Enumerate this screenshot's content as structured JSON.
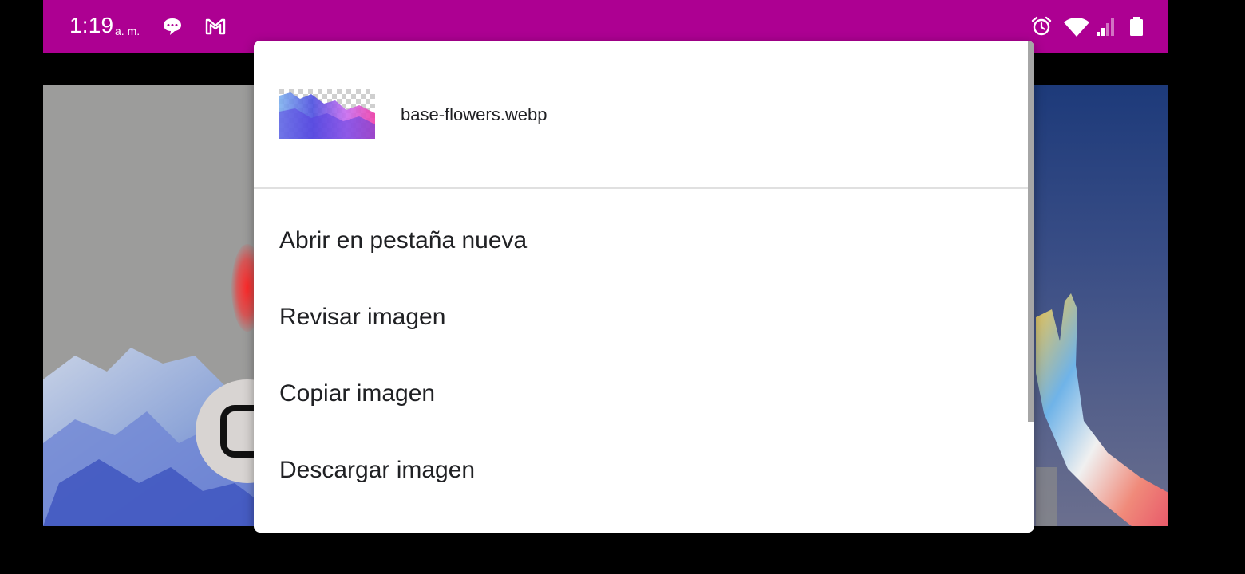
{
  "status_bar": {
    "time": "1:19",
    "ampm": "a. m.",
    "icons": [
      "chat-bubble-icon",
      "gmail-icon",
      "alarm-icon",
      "wifi-icon",
      "signal-icon",
      "battery-icon"
    ],
    "background_color": "#ad0092"
  },
  "context_menu": {
    "filename": "base-flowers.webp",
    "items": [
      {
        "label": "Abrir en pestaña nueva"
      },
      {
        "label": "Revisar imagen"
      },
      {
        "label": "Copiar imagen"
      },
      {
        "label": "Descargar imagen"
      }
    ]
  },
  "colors": {
    "dialog_background": "#ffffff",
    "text": "#202124",
    "divider": "#e0e0e0"
  }
}
